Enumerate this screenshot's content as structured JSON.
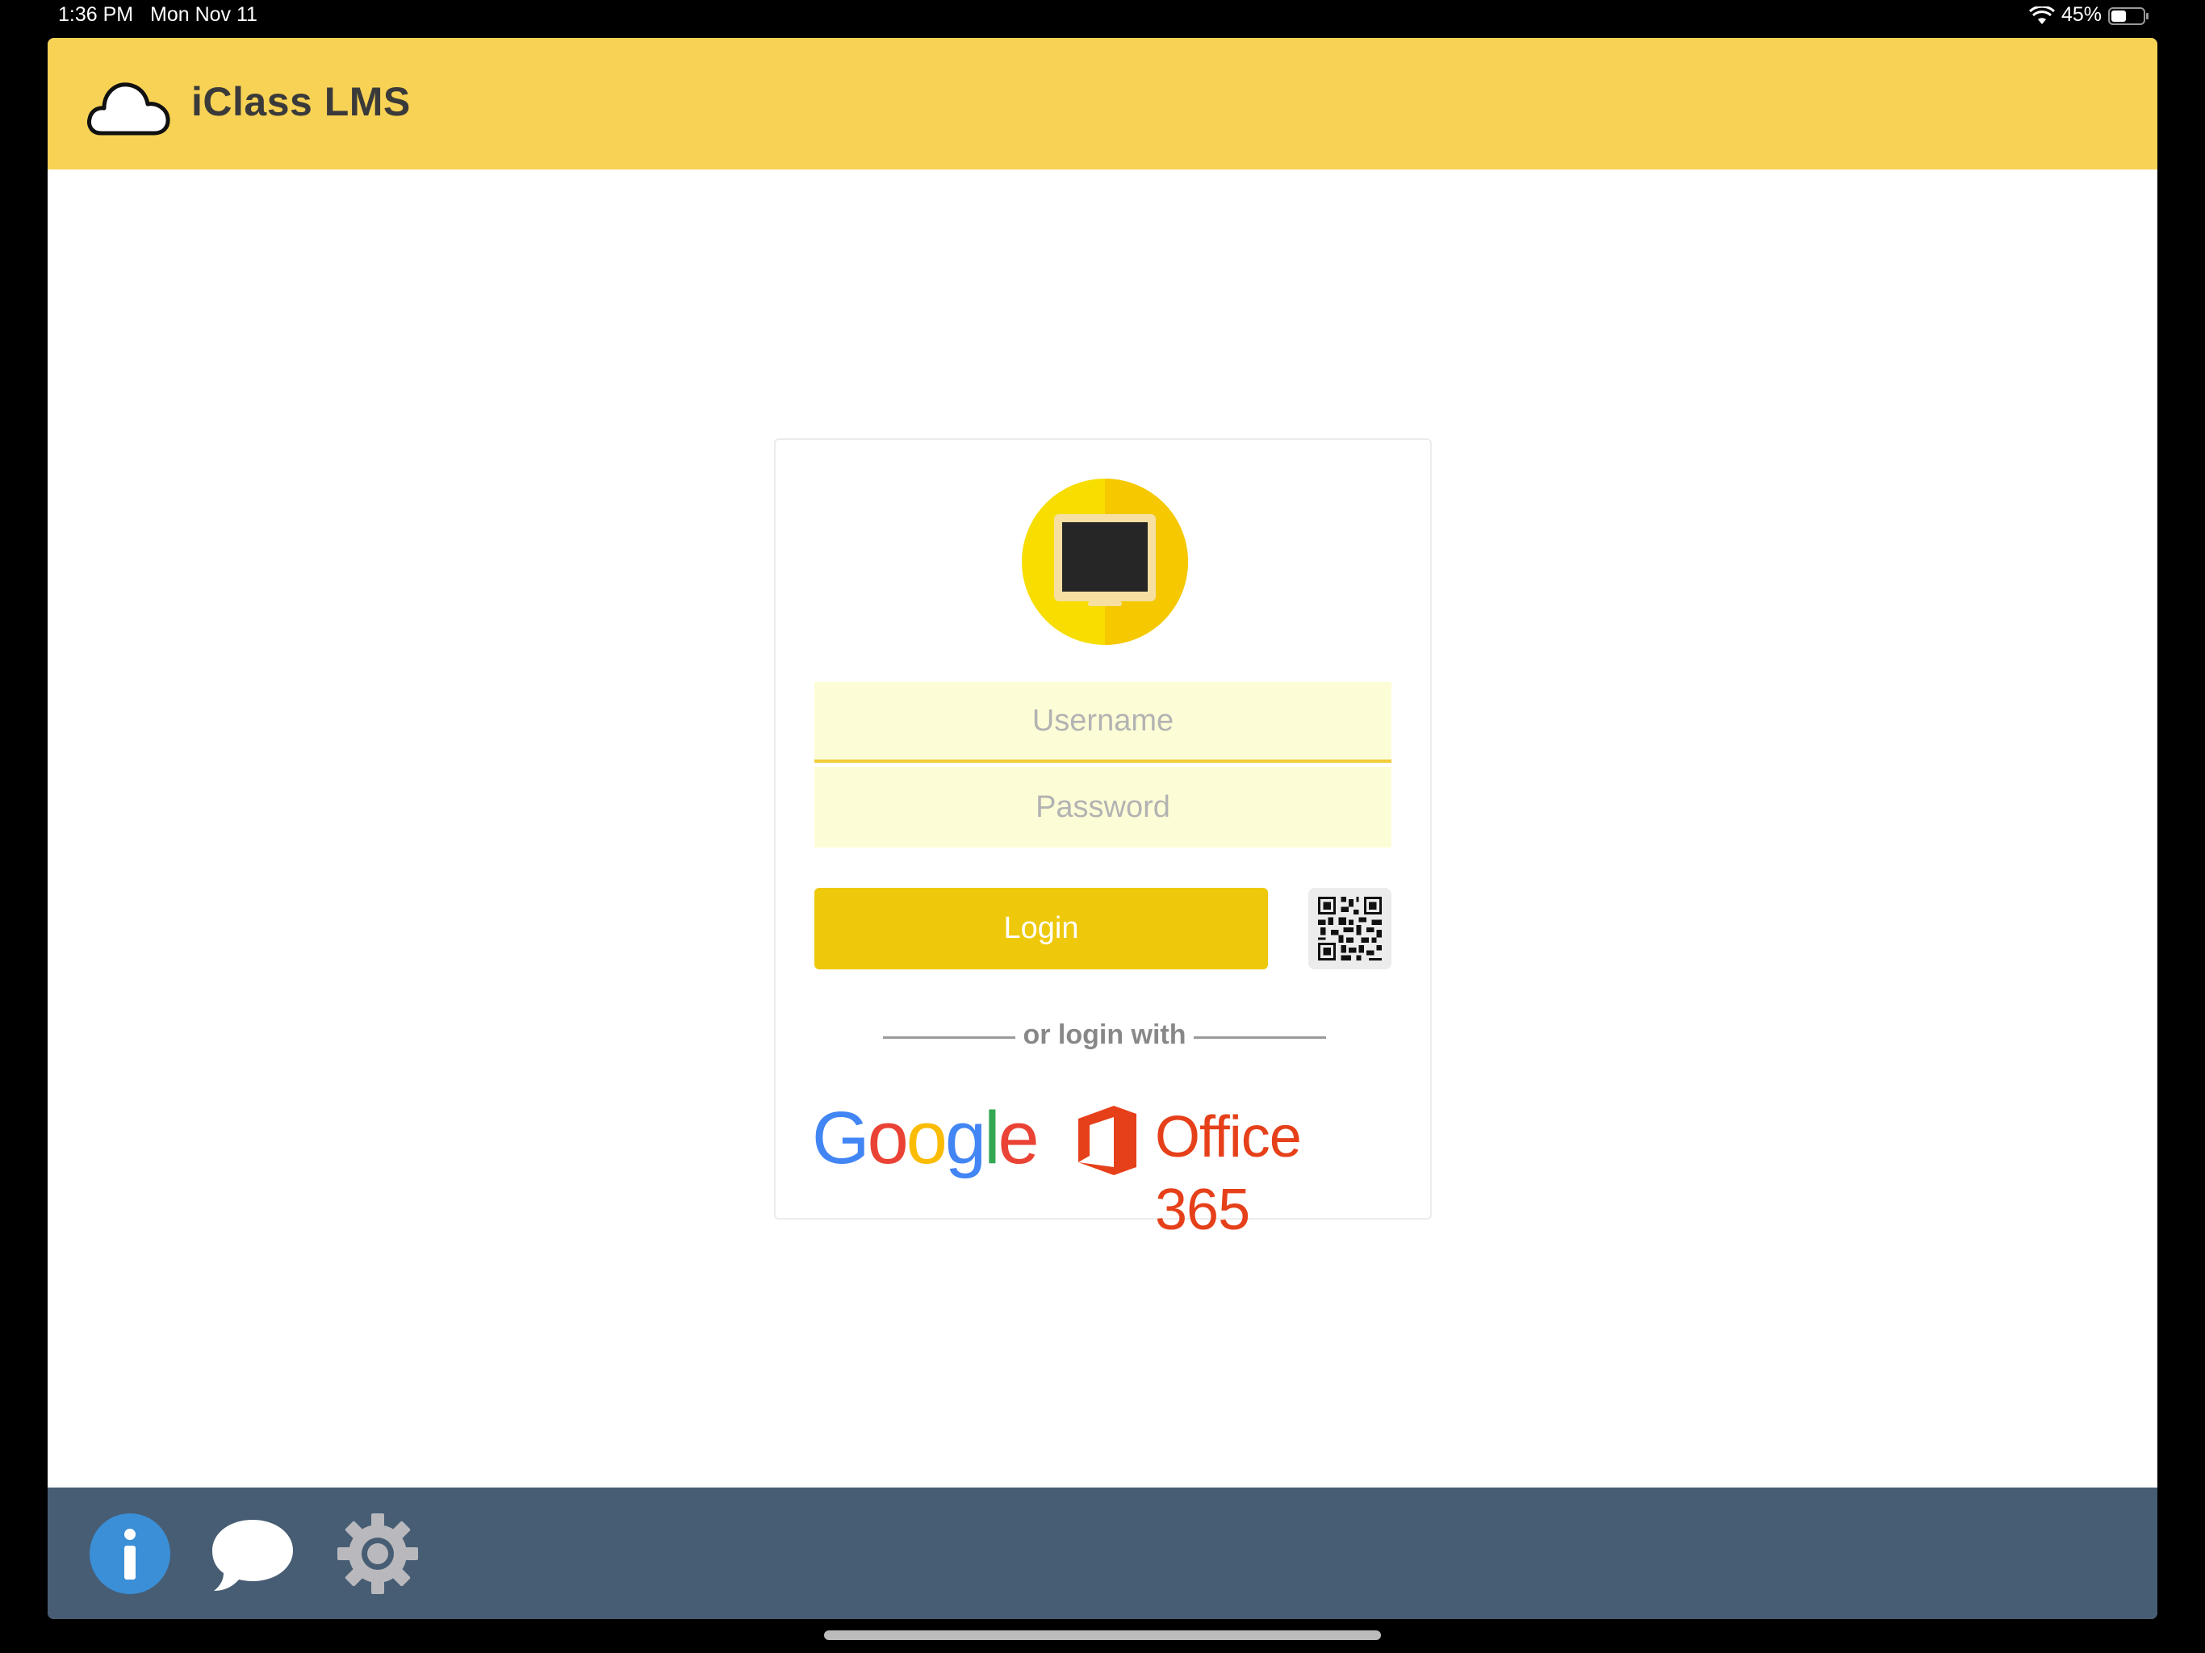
{
  "status_bar": {
    "time": "1:36 PM",
    "date": "Mon Nov 11",
    "battery": "45%",
    "icons": [
      "wifi-icon",
      "battery-icon"
    ]
  },
  "header": {
    "title": "iClass LMS",
    "icon": "cloud-icon",
    "color": "#f8d255"
  },
  "login": {
    "logo_icon": "monitor-icon",
    "username_placeholder": "Username",
    "username_value": "",
    "password_placeholder": "Password",
    "password_value": "",
    "login_label": "Login",
    "qr_icon": "qr-code-icon",
    "divider_text": "or login with",
    "providers": {
      "google": "Google",
      "office": "Office 365"
    },
    "colors": {
      "field_bg": "#fcfdd6",
      "button": "#eec90b"
    }
  },
  "toolbar": {
    "color": "#475d74",
    "icons": [
      "info-icon",
      "chat-bubble-icon",
      "gear-icon"
    ]
  }
}
